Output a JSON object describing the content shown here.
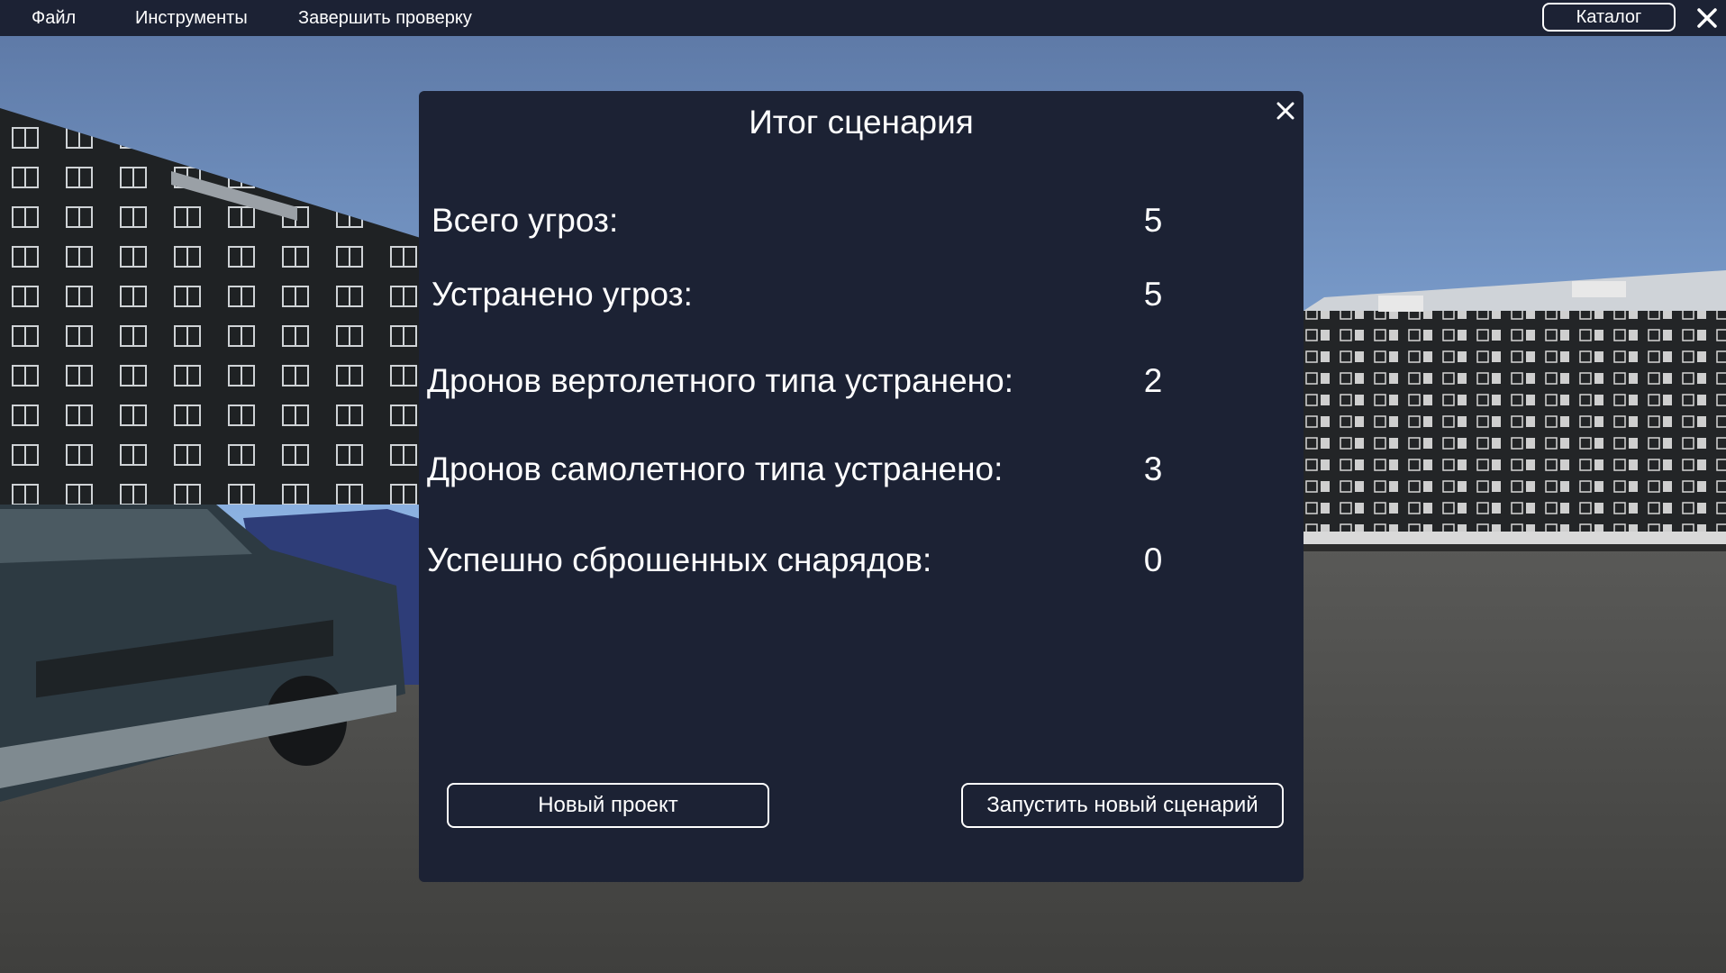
{
  "menu": {
    "file": "Файл",
    "tools": "Инструменты",
    "finish_check": "Завершить проверку",
    "catalog": "Каталог"
  },
  "modal": {
    "title": "Итог сценария",
    "stats": [
      {
        "label": "Всего угроз:",
        "value": "5"
      },
      {
        "label": "Устранено угроз:",
        "value": "5"
      },
      {
        "label": "Дронов вертолетного типа устранено:",
        "value": "2"
      },
      {
        "label": "Дронов самолетного типа устранено:",
        "value": "3"
      },
      {
        "label": "Успешно сброшенных снарядов:",
        "value": "0"
      }
    ],
    "new_project": "Новый проект",
    "new_scenario": "Запустить новый сценарий"
  },
  "icons": {
    "app_close": "close-icon",
    "modal_close": "close-icon"
  },
  "colors": {
    "panel": "#1c2234",
    "text": "#ffffff"
  }
}
